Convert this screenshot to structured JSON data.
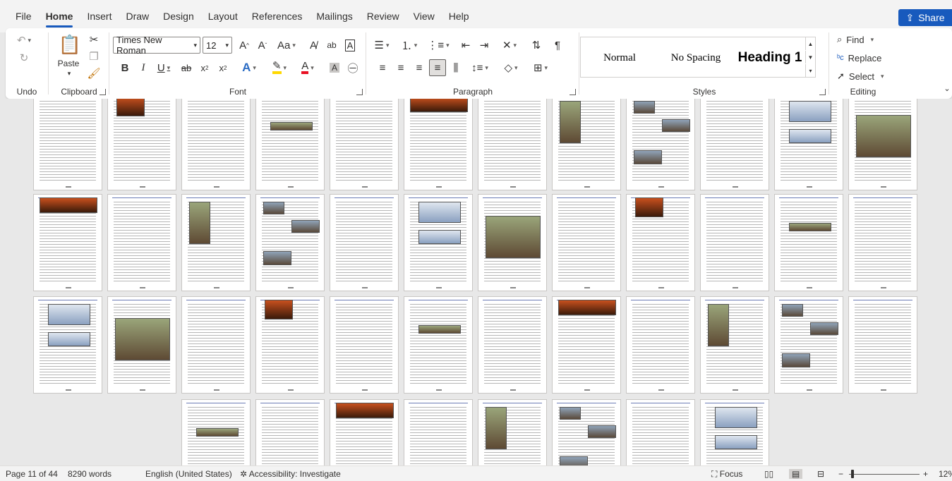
{
  "menu": {
    "tabs": [
      "File",
      "Home",
      "Insert",
      "Draw",
      "Design",
      "Layout",
      "References",
      "Mailings",
      "Review",
      "View",
      "Help"
    ],
    "active_tab": "Home",
    "share_label": "Share"
  },
  "ribbon": {
    "undo": {
      "label": "Undo"
    },
    "clipboard": {
      "label": "Clipboard",
      "paste_label": "Paste"
    },
    "font": {
      "label": "Font",
      "font_name": "Times New Roman",
      "font_size": "12"
    },
    "paragraph": {
      "label": "Paragraph"
    },
    "styles": {
      "label": "Styles",
      "items": [
        "Normal",
        "No Spacing",
        "Heading 1"
      ]
    },
    "editing": {
      "label": "Editing",
      "find": "Find",
      "replace": "Replace",
      "select": "Select"
    }
  },
  "document": {
    "rows": [
      {
        "count": 12
      },
      {
        "count": 12
      },
      {
        "count": 12
      },
      {
        "count": 8
      }
    ]
  },
  "status": {
    "page": "Page 11 of 44",
    "words": "8290 words",
    "language": "English (United States)",
    "accessibility": "Accessibility: Investigate",
    "focus": "Focus",
    "zoom": "12%"
  }
}
